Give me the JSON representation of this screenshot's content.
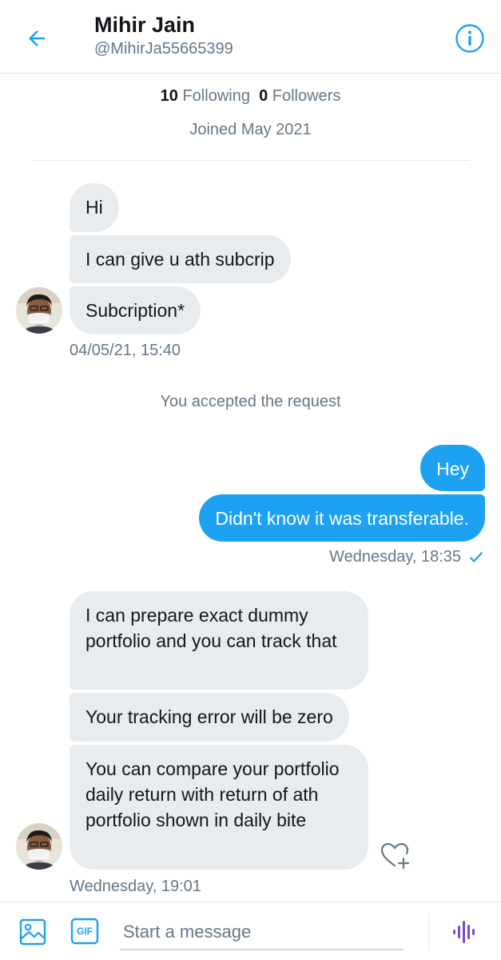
{
  "header": {
    "name": "Mihir Jain",
    "handle": "@MihirJa55665399",
    "back_icon": "arrow-left-icon",
    "info_icon": "info-icon"
  },
  "profile": {
    "following_count": "10",
    "following_label": "Following",
    "followers_count": "0",
    "followers_label": "Followers",
    "joined": "Joined May 2021"
  },
  "conversation": {
    "group1": {
      "messages": [
        "Hi",
        "I can give u ath subcrip",
        "Subcription*"
      ],
      "timestamp": "04/05/21, 15:40"
    },
    "system_notice": "You accepted the request",
    "group2": {
      "messages": [
        "Hey",
        "Didn't know it was transferable."
      ],
      "timestamp": "Wednesday, 18:35"
    },
    "group3": {
      "messages": [
        "I can prepare exact dummy portfolio and you can track that",
        "Your tracking error will be zero",
        "You can compare your portfolio daily return with return of ath portfolio shown in daily bite"
      ],
      "timestamp": "Wednesday, 19:01"
    }
  },
  "composer": {
    "placeholder": "Start a message",
    "gif_label": "GIF",
    "image_icon": "image-icon",
    "voice_icon": "voice-icon"
  },
  "colors": {
    "accent": "#1da1f2",
    "incoming_bubble": "#e8ecef",
    "secondary_text": "#657786",
    "voice": "#794bc4"
  }
}
